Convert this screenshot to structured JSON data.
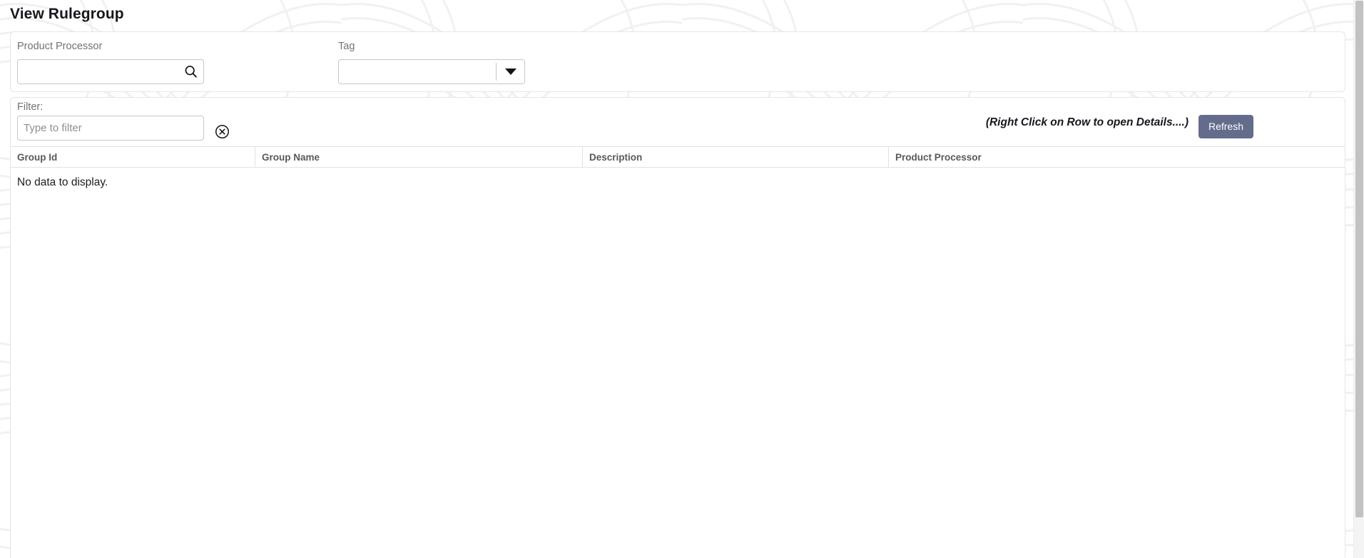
{
  "page": {
    "title": "View Rulegroup"
  },
  "search_panel": {
    "product_processor": {
      "label": "Product Processor",
      "value": "",
      "placeholder": "",
      "search_icon": "search-icon"
    },
    "tag": {
      "label": "Tag",
      "value": "",
      "placeholder": "",
      "dropdown_icon": "chevron-down-icon"
    }
  },
  "results_panel": {
    "filter": {
      "label": "Filter:",
      "value": "",
      "placeholder": "Type to filter",
      "clear_icon": "circle-x-icon"
    },
    "hint": "(Right Click on Row to open Details....)",
    "refresh_label": "Refresh",
    "table": {
      "columns": [
        "Group Id",
        "Group Name",
        "Description",
        "Product Processor"
      ],
      "rows": [],
      "empty_message": "No data to display."
    }
  },
  "colors": {
    "accent": "#646c8c",
    "panel_border": "#e6e6e6",
    "input_border": "#c7c7c7",
    "label_text": "#6f7378",
    "header_text": "#57595e",
    "title_text": "#16181d",
    "scrollbar_thumb": "#c2c2c2"
  }
}
